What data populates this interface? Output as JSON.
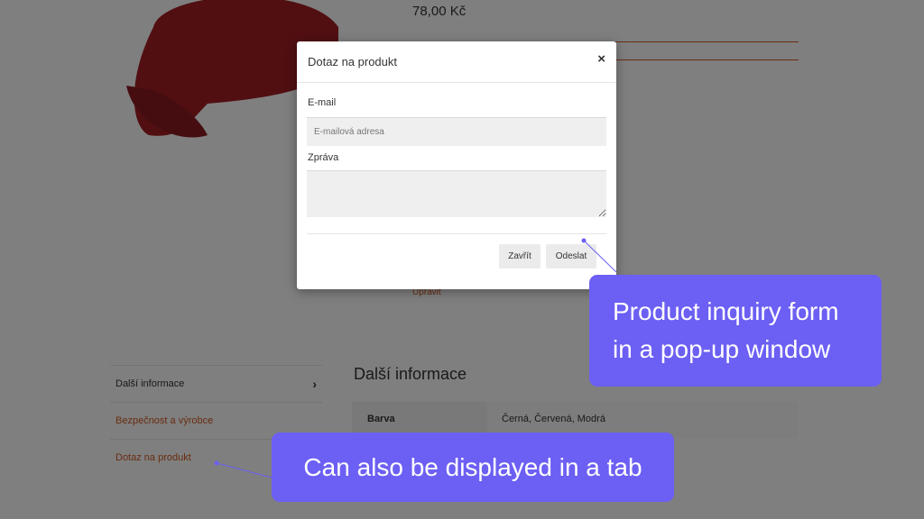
{
  "product": {
    "price": "78,00 Kč",
    "edit_link": "Upravit"
  },
  "tabs": [
    {
      "label": "Další informace",
      "active": true
    },
    {
      "label": "Bezpečnost a výrobce",
      "active": false
    },
    {
      "label": "Dotaz na produkt",
      "active": false
    }
  ],
  "additional_info": {
    "title": "Další informace",
    "rows": [
      {
        "key": "Barva",
        "value": "Černá, Červená, Modrá"
      }
    ]
  },
  "modal": {
    "title": "Dotaz na produkt",
    "close_glyph": "×",
    "email_label": "E-mail",
    "email_placeholder": "E-mailová adresa",
    "email_value": "",
    "message_label": "Zpráva",
    "message_value": "",
    "close_button": "Zavřít",
    "send_button": "Odeslat"
  },
  "callouts": {
    "popup_line1": "Product inquiry form",
    "popup_line2": "in a pop-up window",
    "tab": "Can also be displayed in a tab"
  },
  "colors": {
    "accent_orange": "#d05a20",
    "callout_purple": "#6c5ff3",
    "cap_red": "#a31e25"
  }
}
